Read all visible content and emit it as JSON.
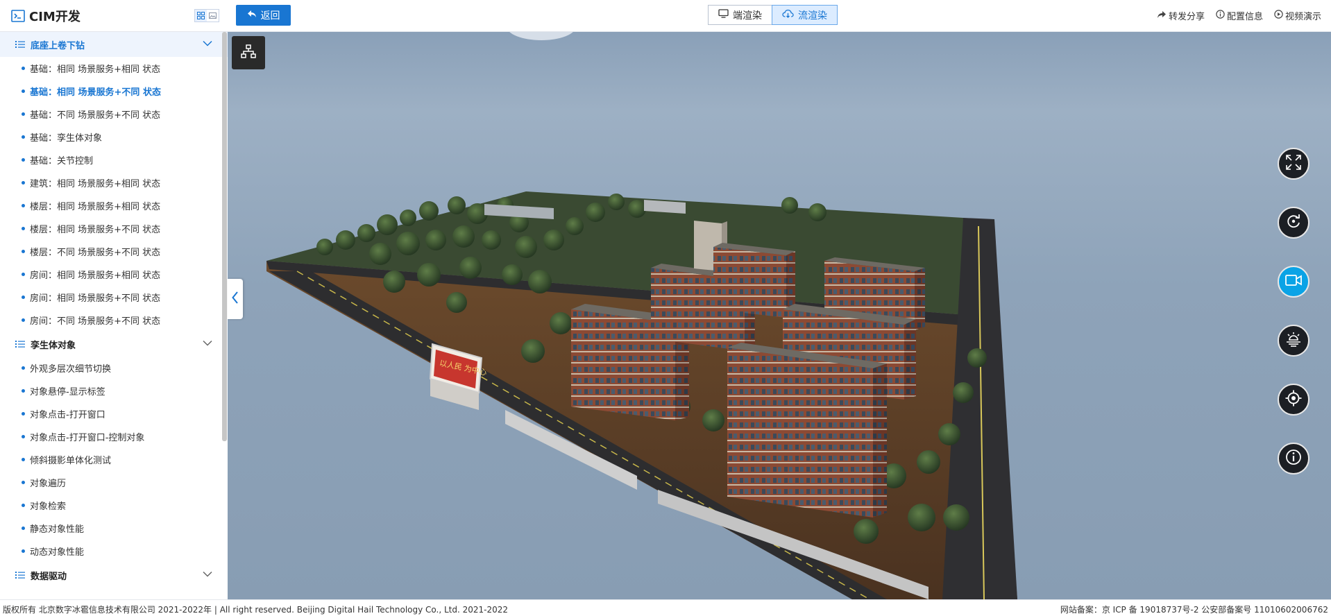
{
  "header": {
    "brand_title": "CIM开发",
    "back_label": "返回",
    "render_tabs": [
      {
        "label": "端渲染",
        "icon": "monitor-icon",
        "active": false
      },
      {
        "label": "流渲染",
        "icon": "cloud-icon",
        "active": true
      }
    ],
    "actions": [
      {
        "label": "转发分享",
        "icon": "share-icon"
      },
      {
        "label": "配置信息",
        "icon": "info-icon"
      },
      {
        "label": "视频演示",
        "icon": "play-icon"
      }
    ]
  },
  "sidebar": {
    "groups": [
      {
        "title": "底座上卷下钻",
        "expanded": true,
        "active": true,
        "items": [
          {
            "label": "基础：相同 场景服务+相同 状态"
          },
          {
            "label": "基础：相同 场景服务+不同 状态",
            "active": true
          },
          {
            "label": "基础：不同 场景服务+不同 状态"
          },
          {
            "label": "基础：孪生体对象"
          },
          {
            "label": "基础：关节控制"
          },
          {
            "label": "建筑：相同 场景服务+相同 状态"
          },
          {
            "label": "楼层：相同 场景服务+相同 状态"
          },
          {
            "label": "楼层：相同 场景服务+不同 状态"
          },
          {
            "label": "楼层：不同 场景服务+不同 状态"
          },
          {
            "label": "房间：相同 场景服务+相同 状态"
          },
          {
            "label": "房间：相同 场景服务+不同 状态"
          },
          {
            "label": "房间：不同 场景服务+不同 状态"
          }
        ]
      },
      {
        "title": "孪生体对象",
        "expanded": true,
        "items": [
          {
            "label": "外观多层次细节切换"
          },
          {
            "label": "对象悬停-显示标签"
          },
          {
            "label": "对象点击-打开窗口"
          },
          {
            "label": "对象点击-打开窗口-控制对象"
          },
          {
            "label": "倾斜摄影单体化测试"
          },
          {
            "label": "对象遍历"
          },
          {
            "label": "对象检索"
          },
          {
            "label": "静态对象性能"
          },
          {
            "label": "动态对象性能"
          }
        ]
      },
      {
        "title": "数据驱动",
        "expanded": true,
        "items": []
      }
    ]
  },
  "viewport": {
    "controls": [
      {
        "icon": "fullscreen-icon"
      },
      {
        "icon": "reset-rotate-icon"
      },
      {
        "icon": "camera-record-icon",
        "active": true
      },
      {
        "icon": "weather-icon"
      },
      {
        "icon": "location-target-icon"
      },
      {
        "icon": "info-icon"
      }
    ],
    "billboard_text": "以人民 为中心"
  },
  "footer": {
    "copyright": "版权所有 北京数字冰雹信息技术有限公司 2021-2022年 | All right reserved. Beijing Digital Hail Technology Co., Ltd. 2021-2022",
    "icp": "网站备案：京 ICP 备 19018737号-2 公安部备案号 11010602006762"
  },
  "colors": {
    "accent": "#1976d2",
    "active_control": "#0aa3e6",
    "sky": "#8ea3b9"
  }
}
